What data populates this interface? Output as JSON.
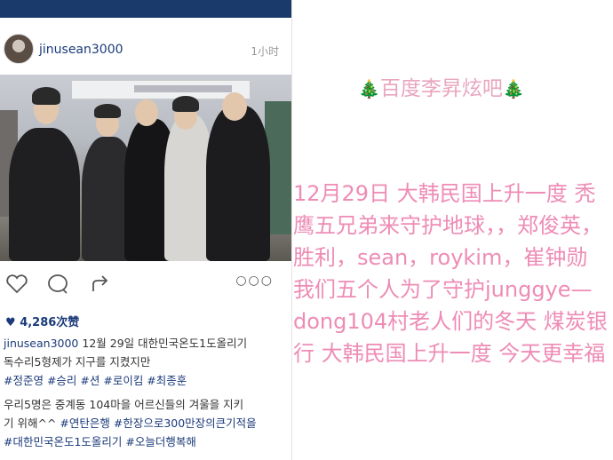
{
  "post": {
    "username": "jinusean3000",
    "time": "1小时",
    "likes": "4,286次赞",
    "more_icon": "more-dots-icon",
    "caption": {
      "username": "jinusean3000",
      "line1": "12월 29일 대한민국온도1도올리기",
      "line2": "독수리5형제가 지구를 지켰지만",
      "tags1": "#정준영 #승리 #션 #로이킴 #최종훈",
      "line3": "우리5명은 중계동 104마을 어르신들의 겨울을 지키",
      "line4a": "기 위해^^ ",
      "tags2": "#연탄은행 #한장으로300만장의큰기적을",
      "tags3": "#대한민국온도1도올리기 #오늘더행복해"
    }
  },
  "watermark": {
    "text": "百度李昇炫吧",
    "tree_icon": "🎄"
  },
  "translation": {
    "text": "12月29日 大韩民国上升一度 秃鹰五兄弟来守护地球，，郑俊英，胜利，sean，roykim，崔钟勋 我们五个人为了守护junggye—dong104村老人们的冬天 煤炭银行 大韩民国上升一度 今天更幸福"
  },
  "colors": {
    "status_bar": "#1a3a6b",
    "link": "#1b3a7a",
    "pink_text": "#ee8cb5",
    "title_pink": "#e8a6bf"
  }
}
